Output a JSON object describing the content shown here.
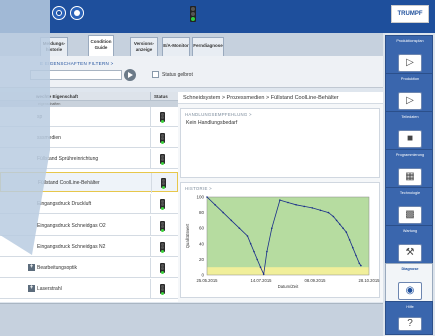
{
  "top_logo": "TRUMPF",
  "tabs": [
    {
      "label": "Meldungs-\nhistorie"
    },
    {
      "label": "Condition\nGuide"
    },
    {
      "label": "Versions-\nanzeige"
    },
    {
      "label": "E/A-Monitor"
    },
    {
      "label": "Ferndiagnose"
    }
  ],
  "filter": {
    "label": "E EIGENSCHAFTEN FILTERN >",
    "value": "",
    "status_label": "Status gelbrot"
  },
  "list": {
    "col_property": "wechte Eigenschaft",
    "col_status": "Status",
    "subheader": "eigenschaften",
    "rows": [
      {
        "label": "sp"
      },
      {
        "label": "sssmedien"
      },
      {
        "label": "Füllstand Sprühreinrichtung"
      },
      {
        "label": "Füllstand CoolLine-Behälter"
      },
      {
        "label": "Eingangsdruck Druckluft"
      },
      {
        "label": "Eingangsdruck Schneidgas O2"
      },
      {
        "label": "Eingangsdruck Schneidgas N2"
      },
      {
        "label": "Bearbeitungsoptik"
      },
      {
        "label": "Laserstrahl"
      }
    ]
  },
  "breadcrumb": "Schneidsystem > Prozessmedien > Füllstand CoolLine-Behälter",
  "recommendation": {
    "title": "HANDLUNGSEMPFEHLUNG >",
    "text": "Kein Handlungsbedarf"
  },
  "history": {
    "title": "HISTORIE >"
  },
  "chart_data": {
    "type": "line",
    "xlabel": "Datum/Zeit",
    "ylabel": "Qualitätswert",
    "x_ticks": [
      "25.05.2015",
      "14.07.2015",
      "08.09.2015",
      "28.10.2015"
    ],
    "y_ticks": [
      "0",
      "20",
      "40",
      "60",
      "80",
      "100"
    ],
    "ylim": [
      0,
      100
    ],
    "series": [
      {
        "values_description": "saw-tooth fill level",
        "x": [
          0,
          5,
          10,
          15,
          20,
          25,
          27,
          29,
          31,
          33,
          35,
          37,
          40,
          45,
          50,
          55,
          60,
          65,
          70,
          75,
          78,
          80,
          82,
          84,
          86,
          88,
          90,
          92,
          94,
          95
        ],
        "y": [
          100,
          90,
          80,
          70,
          60,
          50,
          40,
          30,
          20,
          10,
          1,
          30,
          60,
          96,
          93,
          90,
          88,
          86,
          83,
          80,
          75,
          70,
          65,
          60,
          55,
          45,
          35,
          25,
          15,
          12
        ]
      }
    ]
  },
  "sidebar": [
    {
      "label": "Produktionsplan",
      "icon": "play-icon"
    },
    {
      "label": "Produktion",
      "icon": "play-icon"
    },
    {
      "label": "Teiledaten",
      "icon": "stop-icon"
    },
    {
      "label": "Programmierung",
      "icon": "layout-icon"
    },
    {
      "label": "Technologie",
      "icon": "grid-icon"
    },
    {
      "label": "Wartung",
      "icon": "wrench-icon"
    },
    {
      "label": "Diagnose",
      "icon": "eye-icon"
    },
    {
      "label": "Hilfe",
      "icon": "help-icon"
    }
  ],
  "colors": {
    "brand_blue": "#1e4f9c",
    "chart_green": "#b6dca0",
    "chart_yellow": "#f1ef9a",
    "chart_line": "#1a2e8a"
  }
}
